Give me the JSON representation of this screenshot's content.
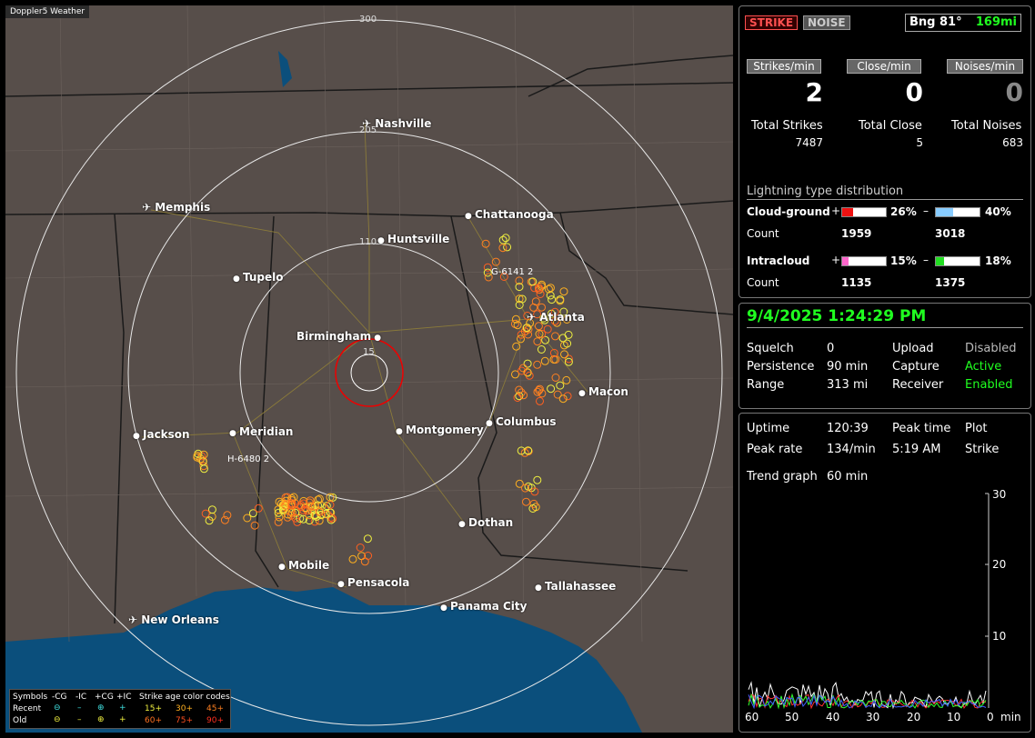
{
  "map": {
    "badge": "Doppler5 Weather",
    "ring_labels": [
      "300",
      "205",
      "110",
      "15"
    ],
    "cities": [
      {
        "name": "Nashville",
        "icon": "airport-icon"
      },
      {
        "name": "Memphis",
        "icon": "airport-icon"
      },
      {
        "name": "Chattanooga",
        "icon": "city-dot-icon"
      },
      {
        "name": "Huntsville",
        "icon": "city-dot-icon"
      },
      {
        "name": "Tupelo",
        "icon": "city-dot-icon"
      },
      {
        "name": "Atlanta",
        "icon": "airport-icon"
      },
      {
        "name": "Birmingham",
        "icon": "city-dot-icon"
      },
      {
        "name": "Macon",
        "icon": "city-dot-icon"
      },
      {
        "name": "Jackson",
        "icon": "city-dot-icon"
      },
      {
        "name": "Meridian",
        "icon": "city-dot-icon"
      },
      {
        "name": "Montgomery",
        "icon": "city-dot-icon"
      },
      {
        "name": "Columbus",
        "icon": "city-dot-icon"
      },
      {
        "name": "Dothan",
        "icon": "city-dot-icon"
      },
      {
        "name": "Mobile",
        "icon": "city-dot-icon"
      },
      {
        "name": "Pensacola",
        "icon": "city-dot-icon"
      },
      {
        "name": "Tallahassee",
        "icon": "city-dot-icon"
      },
      {
        "name": "Panama City",
        "icon": "city-dot-icon"
      },
      {
        "name": "New Orleans",
        "icon": "airport-icon"
      }
    ],
    "cell_labels": [
      "G-6141 2",
      "H-6480 2"
    ],
    "legend": {
      "row_symbols": "Symbols",
      "row_recent": "Recent",
      "row_old": "Old",
      "cols": [
        "-CG",
        "-IC",
        "+CG",
        "+IC"
      ],
      "age_title": "Strike age color codes",
      "recent_ages": [
        "15+",
        "30+",
        "45+"
      ],
      "old_ages": [
        "60+",
        "75+",
        "90+"
      ]
    }
  },
  "status": {
    "strike_label": "STRIKE",
    "noise_label": "NOISE",
    "bearing": "Bng 81°",
    "distance": "169mi",
    "rate_labels": [
      "Strikes/min",
      "Close/min",
      "Noises/min"
    ],
    "rates": [
      "2",
      "0",
      "0"
    ],
    "total_labels": [
      "Total Strikes",
      "Total Close",
      "Total Noises"
    ],
    "totals": [
      "7487",
      "5",
      "683"
    ],
    "dist_title": "Lightning type distribution",
    "cg_label": "Cloud-ground",
    "ic_label": "Intracloud",
    "count_label": "Count",
    "plus": "+",
    "minus": "–",
    "cg_pos_pct": "26%",
    "cg_neg_pct": "40%",
    "ic_pos_pct": "15%",
    "ic_neg_pct": "18%",
    "cg_pos_count": "1959",
    "cg_neg_count": "3018",
    "ic_pos_count": "1135",
    "ic_neg_count": "1375",
    "cg_pos_frac": 0.26,
    "cg_neg_frac": 0.4,
    "ic_pos_frac": 0.15,
    "ic_neg_frac": 0.18
  },
  "settings": {
    "datetime": "9/4/2025 1:24:29 PM",
    "squelch_label": "Squelch",
    "squelch": "0",
    "persistence_label": "Persistence",
    "persistence": "90 min",
    "range_label": "Range",
    "range": "313 mi",
    "upload_label": "Upload",
    "upload": "Disabled",
    "capture_label": "Capture",
    "capture": "Active",
    "receiver_label": "Receiver",
    "receiver": "Enabled"
  },
  "stats": {
    "uptime_label": "Uptime",
    "uptime": "120:39",
    "peak_time_label": "Peak time",
    "peak_time": "5:19 AM",
    "plot_label": "Plot",
    "peak_rate_label": "Peak rate",
    "peak_rate": "134/min",
    "plot_value": "Strike",
    "trend_label": "Trend graph",
    "trend_value": "60 min",
    "y_ticks": [
      "30",
      "20",
      "10"
    ],
    "x_ticks": [
      "60",
      "50",
      "40",
      "30",
      "20",
      "10",
      "0"
    ],
    "x_unit": "min"
  },
  "colors": {
    "strike_red": "#ff3030",
    "green": "#20ff20",
    "cg_pos": "#ee1111",
    "cg_neg": "#88ccff",
    "ic_pos": "#ff66cc",
    "ic_neg": "#22dd22",
    "water": "#0b4f7c"
  }
}
